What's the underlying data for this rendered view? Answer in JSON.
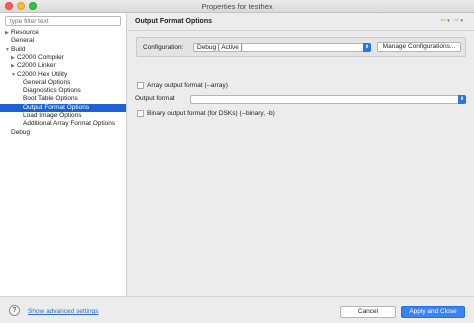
{
  "window": {
    "title": "Properties for testhex"
  },
  "sidebar": {
    "filter_placeholder": "type filter text",
    "tree": [
      {
        "label": "Resource",
        "twisty": "▶",
        "indent": 0,
        "selected": false,
        "name": "tree-item-resource"
      },
      {
        "label": "General",
        "twisty": "",
        "indent": 0,
        "selected": false,
        "name": "tree-item-general"
      },
      {
        "label": "Build",
        "twisty": "▼",
        "indent": 0,
        "selected": false,
        "name": "tree-item-build"
      },
      {
        "label": "C2000 Compiler",
        "twisty": "▶",
        "indent": 1,
        "selected": false,
        "name": "tree-item-c2000-compiler"
      },
      {
        "label": "C2000 Linker",
        "twisty": "▶",
        "indent": 1,
        "selected": false,
        "name": "tree-item-c2000-linker"
      },
      {
        "label": "C2000 Hex Utility",
        "twisty": "▼",
        "indent": 1,
        "selected": false,
        "name": "tree-item-c2000-hex-utility"
      },
      {
        "label": "General Options",
        "twisty": "",
        "indent": 2,
        "selected": false,
        "name": "tree-item-general-options"
      },
      {
        "label": "Diagnostics Options",
        "twisty": "",
        "indent": 2,
        "selected": false,
        "name": "tree-item-diagnostics-options"
      },
      {
        "label": "Boot Table Options",
        "twisty": "",
        "indent": 2,
        "selected": false,
        "name": "tree-item-boot-table-options"
      },
      {
        "label": "Output Format Options",
        "twisty": "",
        "indent": 2,
        "selected": true,
        "name": "tree-item-output-format-options"
      },
      {
        "label": "Load Image Options",
        "twisty": "",
        "indent": 2,
        "selected": false,
        "name": "tree-item-load-image-options"
      },
      {
        "label": "Additional Array Format Options",
        "twisty": "",
        "indent": 2,
        "selected": false,
        "name": "tree-item-additional-array-format-options"
      },
      {
        "label": "Debug",
        "twisty": "",
        "indent": 0,
        "selected": false,
        "name": "tree-item-debug"
      }
    ]
  },
  "page": {
    "title": "Output Format Options",
    "nav": {
      "back_icon": "arrow-left-icon",
      "forward_icon": "arrow-right-icon",
      "dropdown_icon": "chevron-down-icon"
    },
    "configuration": {
      "label": "Configuration:",
      "value": "Debug  [ Active ]",
      "manage_label": "Manage Configurations..."
    },
    "array_output": {
      "label": "Array output format (--array)",
      "checked": false
    },
    "output_format": {
      "label": "Output format",
      "value": ""
    },
    "binary_output": {
      "label": "Binary output format (for DSKs) (--binary, -b)",
      "checked": false
    }
  },
  "footer": {
    "help_icon": "help-icon",
    "help_glyph": "?",
    "advanced_link": "Show advanced settings",
    "cancel_label": "Cancel",
    "apply_label": "Apply and Close"
  },
  "colors": {
    "selection": "#1d62d4",
    "accent": "#3b83ef",
    "link": "#2a6ad4",
    "nav_arrow": "#e0a21f"
  }
}
